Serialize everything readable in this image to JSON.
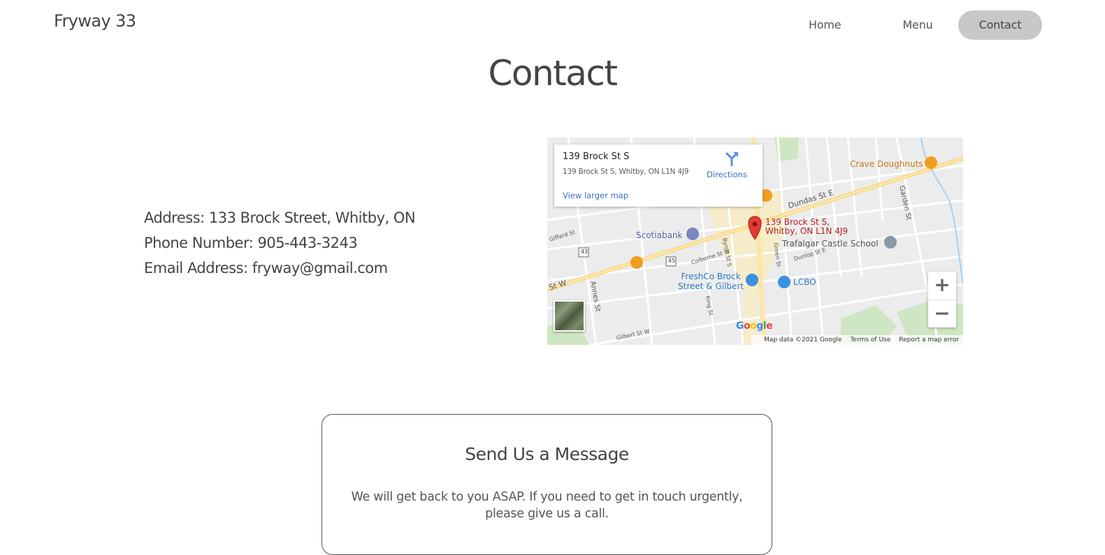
{
  "header": {
    "brand": "Fryway 33",
    "nav": [
      {
        "label": "Home"
      },
      {
        "label": "Menu"
      },
      {
        "label": "Contact",
        "active": true
      }
    ]
  },
  "page_title": "Contact",
  "contact": {
    "address": "Address: 133 Brock Street, Whitby, ON",
    "phone": "Phone Number: 905-443-3243",
    "email": "Email Address: fryway@gmail.com"
  },
  "map": {
    "card": {
      "title": "139 Brock St S",
      "address": "139 Brock St S, Whitby, ON L1N 4J9",
      "directions": "Directions",
      "larger_map": "View larger map"
    },
    "labels": {
      "pin_line1": "139 Brock St S,",
      "pin_line2": "Whitby, ON L1N 4J9",
      "crave": "Crave Doughnuts",
      "dundas": "Dundas St E",
      "scotiabank": "Scotiabank",
      "trafalgar": "Trafalgar Castle School",
      "freshco_1": "FreshCo Brock",
      "freshco_2": "Street & Gilbert",
      "lcbo": "LCBO",
      "garden": "Garden St",
      "annes": "Annes St",
      "st_w": "St W",
      "colborne": "Colborne St W",
      "dunlop": "Dunlop St E",
      "gilbert": "Gilbert St W",
      "giffard": "Giffard St",
      "byron": "Byron St S",
      "green": "Green St",
      "king": "King St",
      "route43": "43",
      "route45": "45"
    },
    "zoom_in": "+",
    "zoom_out": "−",
    "logo": "Google",
    "footer": {
      "data": "Map data ©2021 Google",
      "terms": "Terms of Use",
      "report": "Report a map error"
    }
  },
  "message_box": {
    "title": "Send Us a Message",
    "body": "We will get back to you ASAP. If you need to get in touch urgently, please give us a call."
  },
  "colors": {
    "nav_active_bg": "#c8c8c8",
    "map_link": "#3a6fc4",
    "pin_red": "#e53935"
  }
}
